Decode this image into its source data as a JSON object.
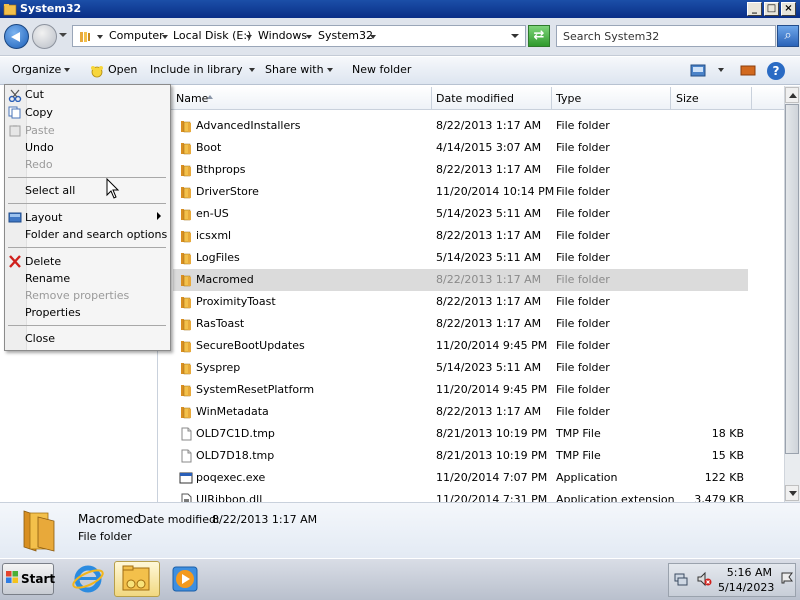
{
  "window": {
    "title": "System32",
    "controls": {
      "minimize": "_",
      "maximize": "□",
      "close": "×"
    }
  },
  "address": {
    "breadcrumbs": [
      "Computer",
      "Local Disk (E:)",
      "Windows",
      "System32"
    ],
    "search_placeholder": "Search System32",
    "search_icon": "search-icon",
    "refresh_icon": "refresh-icon"
  },
  "toolbar": {
    "organize": "Organize",
    "open": "Open",
    "include_in_library": "Include in library",
    "share_with": "Share with",
    "new_folder": "New folder",
    "help": "?"
  },
  "columns": [
    "Name",
    "Date modified",
    "Type",
    "Size"
  ],
  "files": [
    {
      "name": "AdvancedInstallers",
      "date": "8/22/2013 1:17 AM",
      "type": "File folder",
      "size": "",
      "icon": "folder-icon"
    },
    {
      "name": "Boot",
      "date": "4/14/2015 3:07 AM",
      "type": "File folder",
      "size": "",
      "icon": "folder-icon"
    },
    {
      "name": "Bthprops",
      "date": "8/22/2013 1:17 AM",
      "type": "File folder",
      "size": "",
      "icon": "folder-icon"
    },
    {
      "name": "DriverStore",
      "date": "11/20/2014 10:14 PM",
      "type": "File folder",
      "size": "",
      "icon": "folder-icon"
    },
    {
      "name": "en-US",
      "date": "5/14/2023 5:11 AM",
      "type": "File folder",
      "size": "",
      "icon": "folder-icon"
    },
    {
      "name": "icsxml",
      "date": "8/22/2013 1:17 AM",
      "type": "File folder",
      "size": "",
      "icon": "folder-icon"
    },
    {
      "name": "LogFiles",
      "date": "5/14/2023 5:11 AM",
      "type": "File folder",
      "size": "",
      "icon": "folder-icon"
    },
    {
      "name": "Macromed",
      "date": "8/22/2013 1:17 AM",
      "type": "File folder",
      "size": "",
      "icon": "folder-icon",
      "selected": true
    },
    {
      "name": "ProximityToast",
      "date": "8/22/2013 1:17 AM",
      "type": "File folder",
      "size": "",
      "icon": "folder-icon"
    },
    {
      "name": "RasToast",
      "date": "8/22/2013 1:17 AM",
      "type": "File folder",
      "size": "",
      "icon": "folder-icon"
    },
    {
      "name": "SecureBootUpdates",
      "date": "11/20/2014 9:45 PM",
      "type": "File folder",
      "size": "",
      "icon": "folder-icon"
    },
    {
      "name": "Sysprep",
      "date": "5/14/2023 5:11 AM",
      "type": "File folder",
      "size": "",
      "icon": "folder-icon"
    },
    {
      "name": "SystemResetPlatform",
      "date": "11/20/2014 9:45 PM",
      "type": "File folder",
      "size": "",
      "icon": "folder-icon"
    },
    {
      "name": "WinMetadata",
      "date": "8/22/2013 1:17 AM",
      "type": "File folder",
      "size": "",
      "icon": "folder-icon"
    },
    {
      "name": "OLD7C1D.tmp",
      "date": "8/21/2013 10:19 PM",
      "type": "TMP File",
      "size": "18 KB",
      "icon": "tmp-file-icon"
    },
    {
      "name": "OLD7D18.tmp",
      "date": "8/21/2013 10:19 PM",
      "type": "TMP File",
      "size": "15 KB",
      "icon": "tmp-file-icon"
    },
    {
      "name": "poqexec.exe",
      "date": "11/20/2014 7:07 PM",
      "type": "Application",
      "size": "122 KB",
      "icon": "application-icon"
    },
    {
      "name": "UIRibbon.dll",
      "date": "11/20/2014 7:31 PM",
      "type": "Application extension",
      "size": "3,479 KB",
      "icon": "dll-file-icon"
    }
  ],
  "context_menu": {
    "items": [
      {
        "label": "Cut",
        "enabled": true,
        "icon": "scissors-icon"
      },
      {
        "label": "Copy",
        "enabled": true,
        "icon": "copy-icon"
      },
      {
        "label": "Paste",
        "enabled": false,
        "icon": "paste-icon"
      },
      {
        "label": "Undo",
        "enabled": true
      },
      {
        "label": "Redo",
        "enabled": false
      },
      {
        "label": "Select all",
        "enabled": true
      },
      {
        "label": "Layout",
        "enabled": true,
        "icon": "layout-icon",
        "submenu": true
      },
      {
        "label": "Folder and search options",
        "enabled": true
      },
      {
        "label": "Delete",
        "enabled": true,
        "icon": "delete-icon"
      },
      {
        "label": "Rename",
        "enabled": true
      },
      {
        "label": "Remove properties",
        "enabled": false
      },
      {
        "label": "Properties",
        "enabled": true
      },
      {
        "label": "Close",
        "enabled": true
      }
    ]
  },
  "details": {
    "name": "Macromed",
    "date_label": "Date modified:",
    "date_value": "8/22/2013 1:17 AM",
    "type": "File folder"
  },
  "taskbar": {
    "start_label": "Start",
    "items": [
      "internet-explorer-icon",
      "windows-explorer-icon",
      "media-player-icon"
    ],
    "clock_time": "5:16 AM",
    "clock_date": "5/14/2023"
  },
  "colors": {
    "titlebar": "#0a2e86",
    "selection": "#dbdbdb",
    "folder": "#e8a93a"
  }
}
